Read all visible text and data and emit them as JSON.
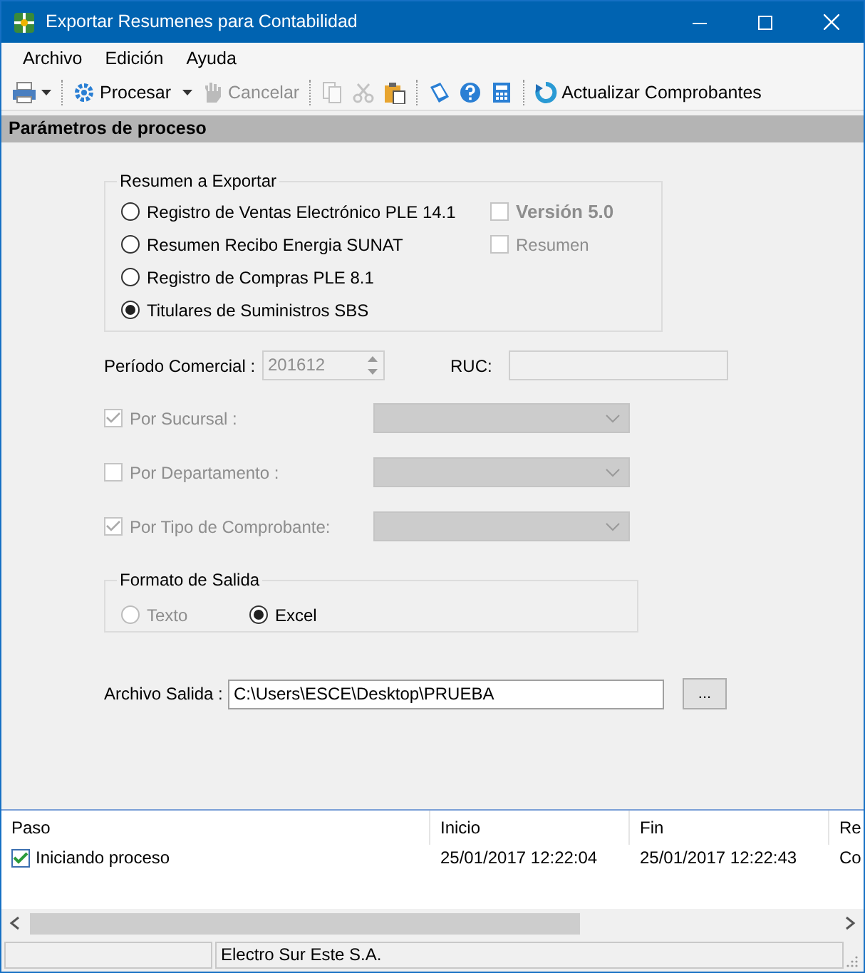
{
  "window": {
    "title": "Exportar Resumenes para Contabilidad"
  },
  "menu": [
    {
      "label": "Archivo"
    },
    {
      "label": "Edición"
    },
    {
      "label": "Ayuda"
    }
  ],
  "toolbar": [
    {
      "kind": "icon-dropdown",
      "disabled": false
    },
    {
      "kind": "separator"
    },
    {
      "kind": "button-dropdown",
      "label": "Procesar",
      "disabled": false
    },
    {
      "kind": "button",
      "label": "Cancelar",
      "disabled": true
    },
    {
      "kind": "separator"
    },
    {
      "kind": "icon",
      "disabled": true
    },
    {
      "kind": "icon",
      "disabled": true
    },
    {
      "kind": "icon",
      "disabled": false
    },
    {
      "kind": "separator"
    },
    {
      "kind": "icon",
      "disabled": false
    },
    {
      "kind": "icon",
      "disabled": false
    },
    {
      "kind": "icon",
      "disabled": false
    },
    {
      "kind": "separator"
    },
    {
      "kind": "button",
      "label": "Actualizar Comprobantes",
      "disabled": false
    }
  ],
  "section_header": "Parámetros de proceso",
  "resumen_group": {
    "legend": "Resumen a Exportar",
    "options": [
      {
        "label": "Registro de Ventas Electrónico PLE 14.1",
        "selected": false
      },
      {
        "label": "Resumen Recibo Energia SUNAT",
        "selected": false
      },
      {
        "label": "Registro de Compras PLE 8.1",
        "selected": false
      },
      {
        "label": "Titulares de Suministros SBS",
        "selected": true
      }
    ],
    "checks": [
      {
        "label": "Versión 5.0",
        "checked": false,
        "disabled": true,
        "bold": true
      },
      {
        "label": "Resumen",
        "checked": false,
        "disabled": true,
        "bold": false
      }
    ]
  },
  "periodo": {
    "label": "Período Comercial :",
    "value": "201612",
    "disabled": true
  },
  "ruc": {
    "label": "RUC:",
    "disabled": true
  },
  "filters": [
    {
      "label": "Por Sucursal :",
      "checked": true,
      "disabled": true
    },
    {
      "label": "Por Departamento :",
      "checked": false,
      "disabled": true
    },
    {
      "label": "Por Tipo de Comprobante:",
      "checked": true,
      "disabled": true
    }
  ],
  "formato_group": {
    "legend": "Formato de Salida",
    "options": [
      {
        "label": "Texto",
        "selected": false,
        "disabled": true
      },
      {
        "label": "Excel",
        "selected": true,
        "disabled": false
      }
    ]
  },
  "archivo": {
    "label": "Archivo Salida :",
    "value": "C:\\Users\\ESCE\\Desktop\\PRUEBA",
    "browse": "..."
  },
  "log": {
    "columns": [
      "Paso",
      "Inicio",
      "Fin",
      "Re"
    ],
    "rows": [
      {
        "checked": true,
        "cells": [
          "Iniciando proceso",
          "25/01/2017 12:22:04",
          "25/01/2017 12:22:43",
          "Co"
        ]
      }
    ]
  },
  "status_bar": {
    "text": "Electro Sur Este S.A."
  }
}
